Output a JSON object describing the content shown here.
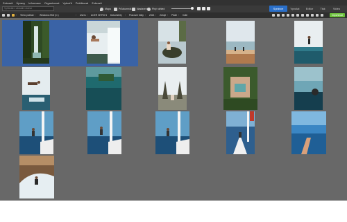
{
  "menu": [
    "Zobrazit",
    "Úpravy",
    "Informace",
    "Organizovat",
    "Vytvořit",
    "Publikovat",
    "Zobrazit"
  ],
  "search": {
    "placeholder": "Vyhledat v aktuální složce"
  },
  "toolbar": {
    "map": "Mapa",
    "favorites": "Průzkumník",
    "settings": "Nastavení",
    "fast_view": "Plný náhled"
  },
  "modes": [
    "Správce",
    "Vyvolat",
    "Editor",
    "Tisk",
    "Video"
  ],
  "active_mode": "Správce",
  "breadcrumb": [
    "Tento počítač",
    "Windows-SSD (C:)",
    "Users",
    "ACER NITRO 5",
    "Dokumenty",
    "Pracovní fotky",
    "2024",
    "Zdroje",
    "Pláže",
    "Indie"
  ],
  "import_label": "Importovat",
  "colors": {
    "background": "#686868",
    "menubar": "#323232",
    "toolbar": "#3a3a3a",
    "accent": "#2a6fc9",
    "selection": "#3a63a6",
    "import": "#6cbf3c"
  },
  "thumbnails": [
    {
      "subject": "waterfall-forest",
      "orientation": "portrait",
      "selected": true
    },
    {
      "subject": "man-jumping-waterfall",
      "orientation": "portrait",
      "selected": true
    },
    {
      "subject": "woman-on-rock-ocean",
      "orientation": "portrait",
      "selected": false
    },
    {
      "subject": "people-on-beach",
      "orientation": "portrait",
      "selected": false
    },
    {
      "subject": "person-jumping-ocean",
      "orientation": "portrait",
      "selected": false
    },
    {
      "subject": "man-jumping-into-sea",
      "orientation": "portrait",
      "selected": false
    },
    {
      "subject": "aerial-island-sea",
      "orientation": "portrait",
      "selected": false
    },
    {
      "subject": "temple-gate",
      "orientation": "portrait",
      "selected": false
    },
    {
      "subject": "aerial-lagoon",
      "orientation": "portrait",
      "selected": false
    },
    {
      "subject": "woman-in-water-sunset",
      "orientation": "portrait",
      "selected": false
    },
    {
      "subject": "man-on-boat-bow",
      "orientation": "portrait",
      "selected": false
    },
    {
      "subject": "man-on-boat-bow",
      "orientation": "portrait",
      "selected": false
    },
    {
      "subject": "man-on-boat-bow",
      "orientation": "portrait",
      "selected": false
    },
    {
      "subject": "man-on-sailboat-deck",
      "orientation": "portrait",
      "selected": false
    },
    {
      "subject": "hand-reaching-sky",
      "orientation": "portrait",
      "selected": false
    },
    {
      "subject": "surfer-wave",
      "orientation": "portrait",
      "selected": false
    }
  ]
}
